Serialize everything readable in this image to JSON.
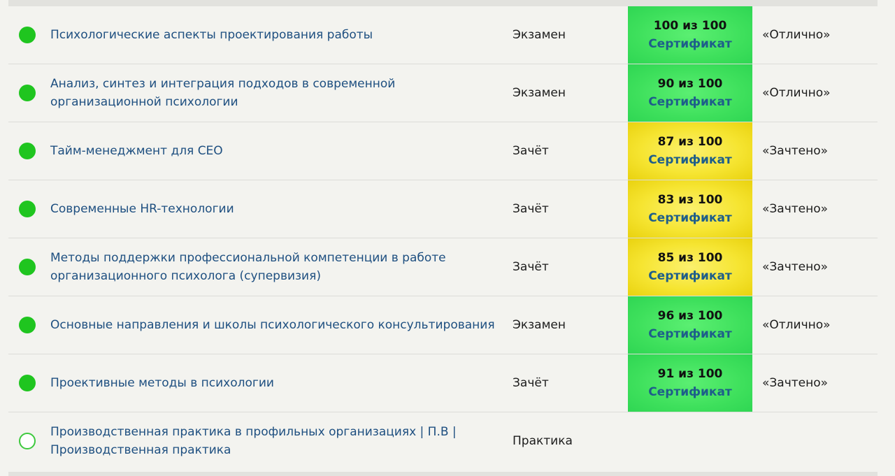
{
  "colors": {
    "link": "#1e4f80",
    "score_green": "#3ee05c",
    "score_yellow": "#f6e532",
    "status_done": "#1fc51f"
  },
  "rows": [
    {
      "status": "done",
      "title": "Психологические аспекты проектирования работы",
      "type": "Экзамен",
      "score": "100 из 100",
      "score_color": "green",
      "certificate": "Сертификат",
      "result": "«Отлично»"
    },
    {
      "status": "done",
      "title": "Анализ, синтез и интеграция подходов в современной организационной психологии",
      "type": "Экзамен",
      "score": "90 из 100",
      "score_color": "green",
      "certificate": "Сертификат",
      "result": "«Отлично»"
    },
    {
      "status": "done",
      "title": "Тайм-менеджмент для CEO",
      "type": "Зачёт",
      "score": "87 из 100",
      "score_color": "yellow",
      "certificate": "Сертификат",
      "result": "«Зачтено»"
    },
    {
      "status": "done",
      "title": "Современные HR-технологии",
      "type": "Зачёт",
      "score": "83 из 100",
      "score_color": "yellow",
      "certificate": "Сертификат",
      "result": "«Зачтено»"
    },
    {
      "status": "done",
      "title": "Методы поддержки профессиональной компетенции в работе организационного психолога (супервизия)",
      "type": "Зачёт",
      "score": "85 из 100",
      "score_color": "yellow",
      "certificate": "Сертификат",
      "result": "«Зачтено»"
    },
    {
      "status": "done",
      "title": "Основные направления и школы психологического консультирования",
      "type": "Экзамен",
      "score": "96 из 100",
      "score_color": "green",
      "certificate": "Сертификат",
      "result": "«Отлично»"
    },
    {
      "status": "done",
      "title": "Проективные методы в психологии",
      "type": "Зачёт",
      "score": "91 из 100",
      "score_color": "green",
      "certificate": "Сертификат",
      "result": "«Зачтено»"
    },
    {
      "status": "pending",
      "title": "Производственная практика в профильных организациях | П.В | Производственная практика",
      "type": "Практика",
      "score": "",
      "score_color": "",
      "certificate": "",
      "result": ""
    }
  ]
}
